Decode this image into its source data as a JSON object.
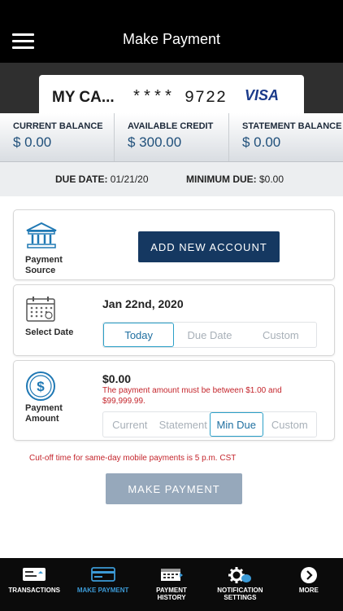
{
  "header": {
    "title": "Make Payment"
  },
  "card": {
    "name": "MY CA...",
    "number": "**** 9722",
    "brand": "VISA"
  },
  "balances": [
    {
      "label": "CURRENT BALANCE",
      "value": "$ 0.00"
    },
    {
      "label": "AVAILABLE CREDIT",
      "value": "$ 300.00"
    },
    {
      "label": "STATEMENT BALANCE",
      "value": "$ 0.00"
    }
  ],
  "due": {
    "date_label": "DUE DATE:",
    "date_value": "01/21/20",
    "min_label": "MINIMUM DUE:",
    "min_value": "$0.00"
  },
  "payment_source": {
    "label_line1": "Payment",
    "label_line2": "Source",
    "button": "ADD NEW ACCOUNT"
  },
  "select_date": {
    "label": "Select Date",
    "selected_date": "Jan 22nd, 2020",
    "options": [
      "Today",
      "Due Date",
      "Custom"
    ],
    "active": "Today"
  },
  "payment_amount": {
    "label_line1": "Payment",
    "label_line2": "Amount",
    "amount": "$0.00",
    "error": "The payment amount must be between $1.00 and $99,999.99.",
    "options": [
      "Current",
      "Statement",
      "Min Due",
      "Custom"
    ],
    "active": "Min Due"
  },
  "cutoff": "Cut-off time for same-day mobile payments is 5 p.m. CST",
  "make_payment_button": "MAKE PAYMENT",
  "nav": [
    {
      "label1": "TRANSACTIONS",
      "label2": "",
      "icon": "transactions-icon"
    },
    {
      "label1": "MAKE PAYMENT",
      "label2": "",
      "icon": "card-icon"
    },
    {
      "label1": "PAYMENT",
      "label2": "HISTORY",
      "icon": "calendar-icon"
    },
    {
      "label1": "NOTIFICATION",
      "label2": "SETTINGS",
      "icon": "gear-chat-icon"
    },
    {
      "label1": "MORE",
      "label2": "",
      "icon": "more-icon"
    }
  ],
  "colors": {
    "accent": "#153861",
    "active_nav": "#3c9ad6",
    "error": "#c4252c",
    "disabled_button": "#96a8bb"
  }
}
